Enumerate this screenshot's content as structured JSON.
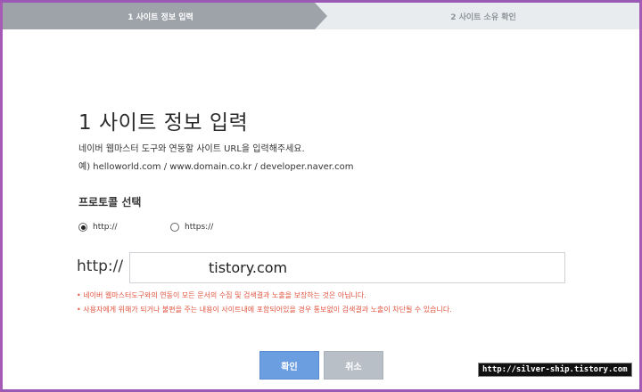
{
  "steps": {
    "step1_label": "1 사이트 정보 입력",
    "step2_label": "2 사이트 소유 확인"
  },
  "main": {
    "title": "1 사이트 정보 입력",
    "description": "네이버 웹마스터 도구와 연동할 사이트 URL을 입력해주세요.",
    "example": "예) helloworld.com / www.domain.co.kr / developer.naver.com",
    "protocol_heading": "프로토콜 선택",
    "protocol_options": [
      {
        "label": "http://",
        "selected": true
      },
      {
        "label": "https://",
        "selected": false
      }
    ],
    "url_prefix": "http://",
    "url_value": "tistory.com",
    "notices": [
      "• 네이버 웹마스터도구와의 연동이 모든 문서의 수집 및 검색결과 노출을 보장하는 것은 아닙니다.",
      "• 사용자에게 위해가 되거나 불편을 주는 내용이 사이트내에 포함되어있을 경우 통보없이 검색결과 노출이 차단될 수 있습니다."
    ],
    "confirm_label": "확인",
    "cancel_label": "취소"
  },
  "watermark": "http://silver-ship.tistory.com",
  "colors": {
    "step_active": "#9ea3aa",
    "step_inactive": "#e9ecef",
    "notice_red": "#e0533f",
    "confirm_blue": "#6b9de1",
    "cancel_gray": "#b8bfc6",
    "frame_purple": "#a55bb5"
  }
}
